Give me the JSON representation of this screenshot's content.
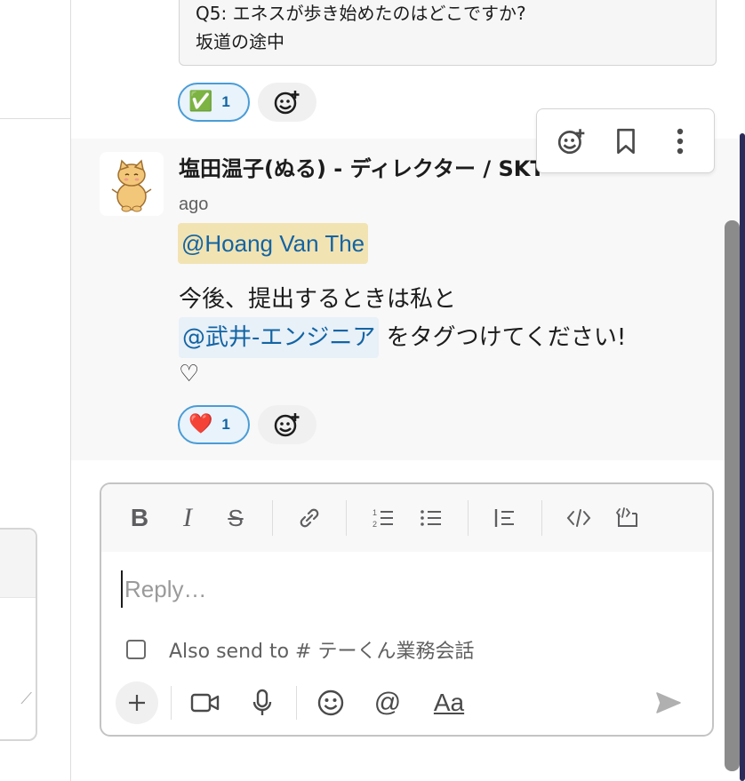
{
  "prev_message": {
    "question_line": "Q5: エネスが歩き始めたのはどこですか?",
    "answer_line": "坂道の途中",
    "reaction": {
      "emoji": "✅",
      "count": "1"
    }
  },
  "message": {
    "author": "塩田温子(ぬる) - ディレクター / SKT ",
    "timestamp_tail": "ago",
    "mention_user": "@Hoang Van The",
    "body_line1": "今後、提出するときは私と",
    "mention_eng": "@武井-エンジニア",
    "body_line2_tail": " をタグつけてください!",
    "body_line3": "♡",
    "reaction": {
      "emoji": "❤️",
      "count": "1"
    }
  },
  "hover_actions": [
    "add-reaction-icon",
    "bookmark-icon",
    "more-actions-icon"
  ],
  "composer": {
    "placeholder": "Reply…",
    "also_send": "Also send to # テーくん業務会話",
    "aa_label": "Aa"
  },
  "colors": {
    "link_blue": "#1264a3",
    "mention_highlight": "#f2e3b3",
    "reaction_border": "#4a9cd6"
  }
}
